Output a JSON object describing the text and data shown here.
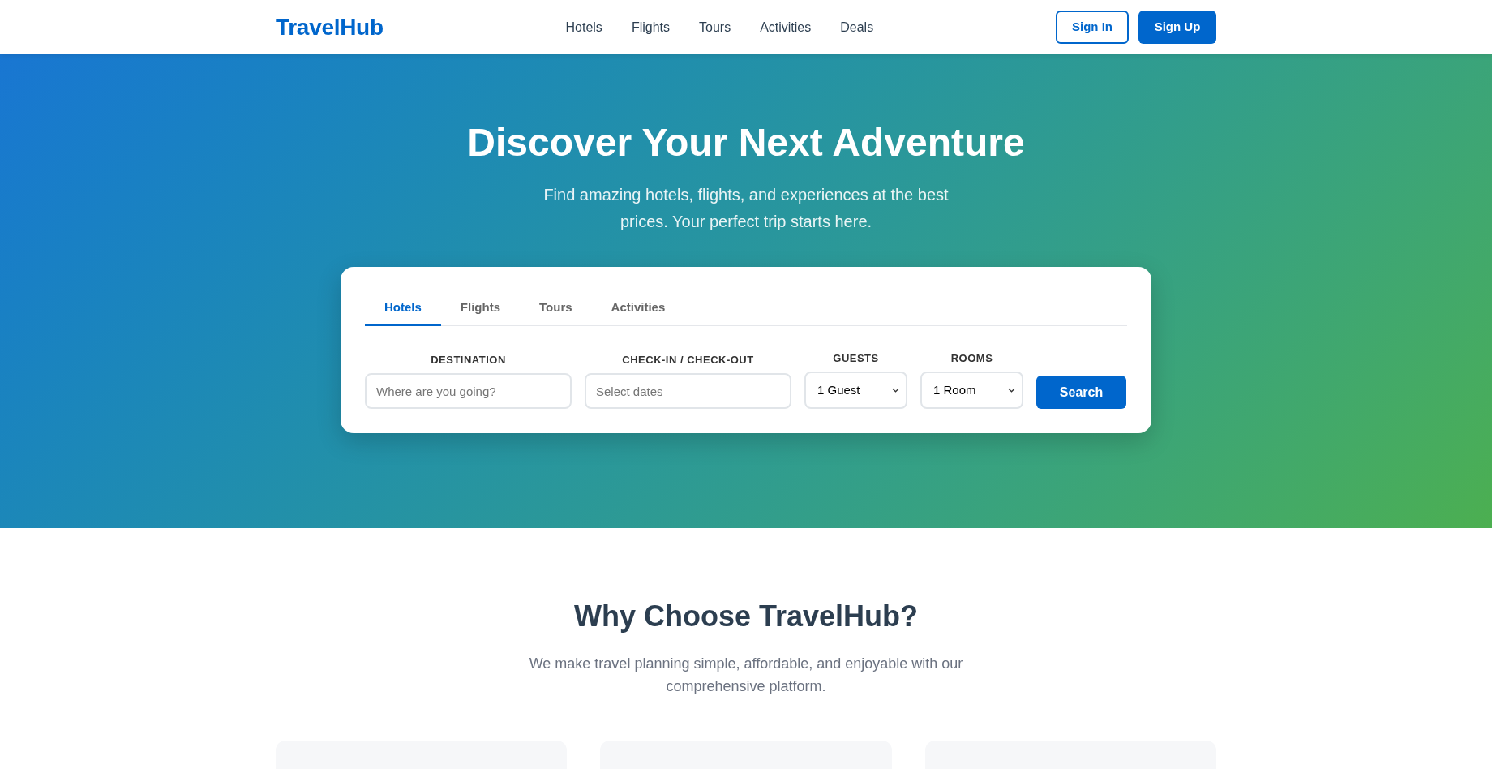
{
  "header": {
    "logo": "TravelHub",
    "nav": [
      "Hotels",
      "Flights",
      "Tours",
      "Activities",
      "Deals"
    ],
    "buttons": [
      {
        "label": "Sign In",
        "kind": "outline"
      },
      {
        "label": "Sign Up",
        "kind": "solid"
      }
    ]
  },
  "hero": {
    "title": "Discover Your Next Adventure",
    "subtitle": "Find amazing hotels, flights, and experiences at the best prices. Your perfect trip starts here.",
    "search": {
      "tabs": [
        {
          "label": "Hotels",
          "selected": true
        },
        {
          "label": "Flights",
          "selected": false
        },
        {
          "label": "Tours",
          "selected": false
        },
        {
          "label": "Activities",
          "selected": false
        }
      ],
      "fields": [
        {
          "kind": "text",
          "label": "DESTINATION",
          "placeholder": "Where are you going?"
        },
        {
          "kind": "text",
          "label": "CHECK-IN / CHECK-OUT",
          "placeholder": "Select dates"
        },
        {
          "kind": "select",
          "label": "GUESTS",
          "value": "1 Guest"
        },
        {
          "kind": "select",
          "label": "ROOMS",
          "value": "1 Room"
        }
      ],
      "button": "Search"
    }
  },
  "features": {
    "title": "Why Choose TravelHub?",
    "subtitle": "We make travel planning simple, affordable, and enjoyable with our comprehensive platform."
  }
}
